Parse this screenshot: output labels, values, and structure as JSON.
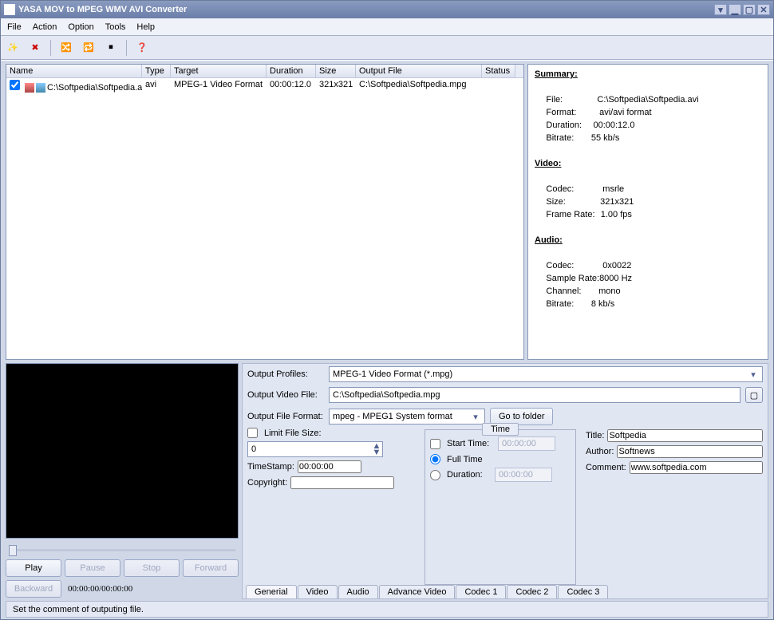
{
  "window": {
    "title": "YASA MOV to MPEG WMV AVI Converter"
  },
  "menu": {
    "file": "File",
    "action": "Action",
    "option": "Option",
    "tools": "Tools",
    "help": "Help"
  },
  "columns": {
    "name": "Name",
    "type": "Type",
    "target": "Target",
    "duration": "Duration",
    "size": "Size",
    "output": "Output File",
    "status": "Status"
  },
  "rows": [
    {
      "name": "C:\\Softpedia\\Softpedia.avi",
      "type": "avi",
      "target": "MPEG-1 Video Format",
      "duration": "00:00:12.0",
      "size": "321x321",
      "output": "C:\\Softpedia\\Softpedia.mpg",
      "status": ""
    }
  ],
  "summary": {
    "hdr_summary": "Summary:",
    "file_lbl": "File:",
    "file_val": "C:\\Softpedia\\Softpedia.avi",
    "format_lbl": "Format:",
    "format_val": "avi/avi format",
    "duration_lbl": "Duration:",
    "duration_val": "00:00:12.0",
    "bitrate_lbl": "Bitrate:",
    "bitrate_val": "55 kb/s",
    "hdr_video": "Video:",
    "vcodec_lbl": "Codec:",
    "vcodec_val": "msrle",
    "vsize_lbl": "Size:",
    "vsize_val": "321x321",
    "vfr_lbl": "Frame Rate:",
    "vfr_val": "1.00 fps",
    "hdr_audio": "Audio:",
    "acodec_lbl": "Codec:",
    "acodec_val": "0x0022",
    "asr_lbl": "Sample Rate:",
    "asr_val": "8000 Hz",
    "ach_lbl": "Channel:",
    "ach_val": "mono",
    "abr_lbl": "Bitrate:",
    "abr_val": "8 kb/s"
  },
  "preview": {
    "play": "Play",
    "pause": "Pause",
    "stop": "Stop",
    "forward": "Forward",
    "backward": "Backward",
    "time": "00:00:00/00:00:00"
  },
  "settings": {
    "profiles_lbl": "Output Profiles:",
    "profiles_val": "MPEG-1 Video Format (*.mpg)",
    "outfile_lbl": "Output Video File:",
    "outfile_val": "C:\\Softpedia\\Softpedia.mpg",
    "outfmt_lbl": "Output File Format:",
    "outfmt_val": "mpeg - MPEG1 System format",
    "goto": "Go to folder",
    "limit_lbl": "Limit File Size:",
    "limit_val": "0",
    "timestamp_lbl": "TimeStamp:",
    "timestamp_val": "00:00:00",
    "copyright_lbl": "Copyright:",
    "copyright_val": "",
    "title_lbl": "Title:",
    "title_val": "Softpedia",
    "author_lbl": "Author:",
    "author_val": "Softnews",
    "comment_lbl": "Comment:",
    "comment_val": "www.softpedia.com",
    "time_legend": "Time",
    "start_lbl": "Start Time:",
    "start_val": "00:00:00",
    "full_lbl": "Full Time",
    "dur_lbl": "Duration:",
    "dur_val": "00:00:00"
  },
  "tabs": {
    "general": "Generial",
    "video": "Video",
    "audio": "Audio",
    "adv": "Advance Video",
    "c1": "Codec 1",
    "c2": "Codec 2",
    "c3": "Codec 3"
  },
  "status": "Set the comment of outputing file."
}
